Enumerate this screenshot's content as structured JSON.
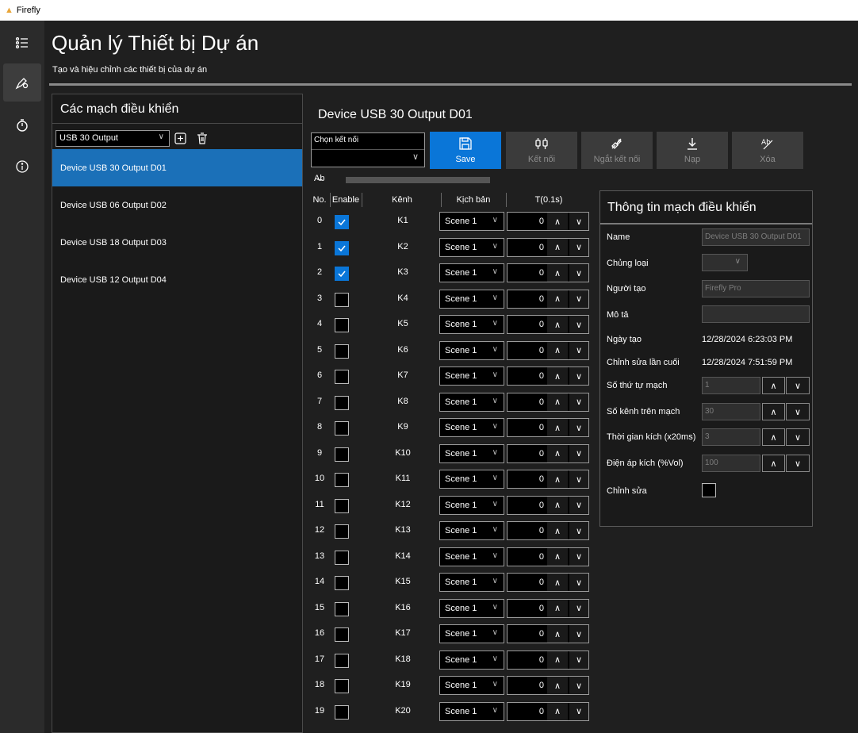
{
  "window": {
    "app_name": "Firefly"
  },
  "sidebar": {
    "items": [
      {
        "name": "list-menu-icon"
      },
      {
        "name": "device-settings-icon",
        "active": true
      },
      {
        "name": "timer-icon"
      },
      {
        "name": "info-icon"
      }
    ]
  },
  "header": {
    "title": "Quản lý Thiết bị Dự án",
    "subtitle": "Tạo và hiệu chỉnh các thiết bị của dự án"
  },
  "left_panel": {
    "title": "Các mạch điều khiển",
    "type_filter": "USB 30 Output",
    "devices": [
      {
        "label": "Device USB 30 Output D01",
        "selected": true
      },
      {
        "label": "Device USB 06 Output D02",
        "selected": false
      },
      {
        "label": "Device USB 18 Output D03",
        "selected": false
      },
      {
        "label": "Device USB 12 Output D04",
        "selected": false
      }
    ]
  },
  "device": {
    "title": "Device USB 30 Output D01",
    "connection_label": "Chọn kết nối",
    "connection_value": "",
    "buttons": {
      "save": "Save",
      "connect": "Kết nối",
      "disconnect": "Ngắt kết nối",
      "load": "Nạp",
      "delete": "Xóa"
    },
    "mini_icon": "A̶b"
  },
  "table": {
    "headers": {
      "no": "No.",
      "enable": "Enable",
      "channel": "Kênh",
      "scene": "Kịch bản",
      "time": "T(0.1s)"
    },
    "rows": [
      {
        "no": "0",
        "enabled": true,
        "channel": "K1",
        "scene": "Scene 1",
        "time": "0"
      },
      {
        "no": "1",
        "enabled": true,
        "channel": "K2",
        "scene": "Scene 1",
        "time": "0"
      },
      {
        "no": "2",
        "enabled": true,
        "channel": "K3",
        "scene": "Scene 1",
        "time": "0"
      },
      {
        "no": "3",
        "enabled": false,
        "channel": "K4",
        "scene": "Scene 1",
        "time": "0"
      },
      {
        "no": "4",
        "enabled": false,
        "channel": "K5",
        "scene": "Scene 1",
        "time": "0"
      },
      {
        "no": "5",
        "enabled": false,
        "channel": "K6",
        "scene": "Scene 1",
        "time": "0"
      },
      {
        "no": "6",
        "enabled": false,
        "channel": "K7",
        "scene": "Scene 1",
        "time": "0"
      },
      {
        "no": "7",
        "enabled": false,
        "channel": "K8",
        "scene": "Scene 1",
        "time": "0"
      },
      {
        "no": "8",
        "enabled": false,
        "channel": "K9",
        "scene": "Scene 1",
        "time": "0"
      },
      {
        "no": "9",
        "enabled": false,
        "channel": "K10",
        "scene": "Scene 1",
        "time": "0"
      },
      {
        "no": "10",
        "enabled": false,
        "channel": "K11",
        "scene": "Scene 1",
        "time": "0"
      },
      {
        "no": "11",
        "enabled": false,
        "channel": "K12",
        "scene": "Scene 1",
        "time": "0"
      },
      {
        "no": "12",
        "enabled": false,
        "channel": "K13",
        "scene": "Scene 1",
        "time": "0"
      },
      {
        "no": "13",
        "enabled": false,
        "channel": "K14",
        "scene": "Scene 1",
        "time": "0"
      },
      {
        "no": "14",
        "enabled": false,
        "channel": "K15",
        "scene": "Scene 1",
        "time": "0"
      },
      {
        "no": "15",
        "enabled": false,
        "channel": "K16",
        "scene": "Scene 1",
        "time": "0"
      },
      {
        "no": "16",
        "enabled": false,
        "channel": "K17",
        "scene": "Scene 1",
        "time": "0"
      },
      {
        "no": "17",
        "enabled": false,
        "channel": "K18",
        "scene": "Scene 1",
        "time": "0"
      },
      {
        "no": "18",
        "enabled": false,
        "channel": "K19",
        "scene": "Scene 1",
        "time": "0"
      },
      {
        "no": "19",
        "enabled": false,
        "channel": "K20",
        "scene": "Scene 1",
        "time": "0"
      }
    ]
  },
  "info": {
    "title": "Thông tin mạch điều khiển",
    "name_label": "Name",
    "name_value": "Device USB 30 Output D01",
    "type_label": "Chủng loại",
    "type_value": "",
    "creator_label": "Người tạo",
    "creator_value": "Firefly Pro",
    "desc_label": "Mô tả",
    "desc_value": "",
    "created_label": "Ngày tạo",
    "created_value": "12/28/2024 6:23:03 PM",
    "modified_label": "Chỉnh sửa lần cuối",
    "modified_value": "12/28/2024 7:51:59 PM",
    "order_label": "Số thứ tự mạch",
    "order_value": "1",
    "channels_label": "Số kênh trên mạch",
    "channels_value": "30",
    "trigger_time_label": "Thời gian kích (x20ms)",
    "trigger_time_value": "3",
    "voltage_label": "Điện áp kích (%Vol)",
    "voltage_value": "100",
    "edit_label": "Chỉnh sửa",
    "edit_checked": false
  },
  "colors": {
    "accent": "#0a76d8",
    "selected_item": "#1b70b8",
    "background": "#1f1f1f"
  }
}
